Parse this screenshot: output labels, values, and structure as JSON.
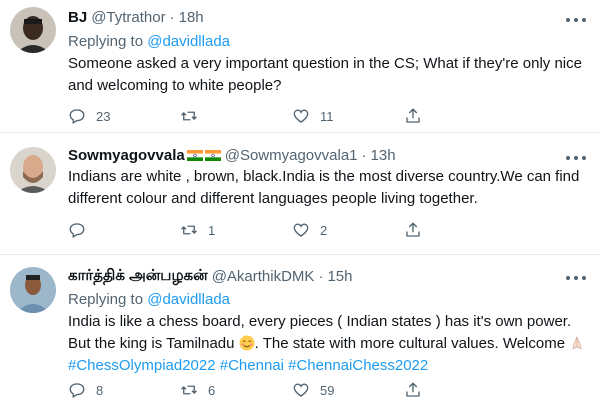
{
  "tweets": [
    {
      "name": "BJ",
      "handle": "@Tytrathor",
      "time": "18h",
      "replying_prefix": "Replying to ",
      "replying_to": "@davidllada",
      "text": "Someone asked a very important question in the CS; What if they're only nice and welcoming to white people?",
      "replies": "23",
      "retweets": "",
      "likes": "11",
      "has_flags": false
    },
    {
      "name": "Sowmyagovvala",
      "handle": "@Sowmyagovvala1",
      "time": "13h",
      "replying_prefix": "",
      "replying_to": "",
      "text": "Indians are white , brown, black.India is the most diverse country.We can find different colour and different languages people living together.",
      "replies": "",
      "retweets": "1",
      "likes": "2",
      "has_flags": true
    },
    {
      "name": "கார்த்திக் அன்பழகன்",
      "handle": "@AkarthikDMK",
      "time": "15h",
      "replying_prefix": "Replying to ",
      "replying_to": "@davidllada",
      "text_part1": "India is like a chess board, every pieces ( Indian states ) has it's own power. But the king is Tamilnadu ",
      "text_part2": ". The state with more cultural values. Welcome ",
      "hashtags": "#ChessOlympiad2022 #Chennai #ChennaiChess2022",
      "replies": "8",
      "retweets": "6",
      "likes": "59",
      "has_flags": false
    }
  ],
  "separator": "·",
  "icons": {
    "reply": "reply-icon",
    "retweet": "retweet-icon",
    "like": "heart-icon",
    "share": "share-icon",
    "more": "more-icon",
    "flag": "india-flag-icon"
  },
  "colors": {
    "link": "#1d9bf0",
    "muted": "#536471",
    "text": "#0f1419",
    "divider": "#e6ecf0"
  }
}
